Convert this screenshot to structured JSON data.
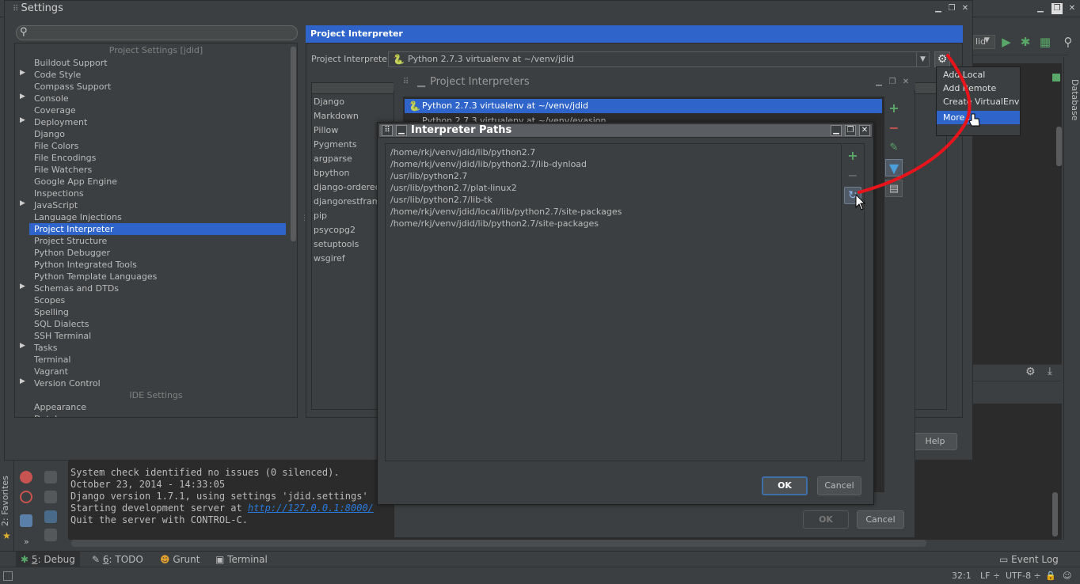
{
  "settings": {
    "title": "Settings",
    "tree_header_project": "Project Settings [jdid]",
    "tree_header_ide": "IDE Settings",
    "tree_items": [
      {
        "label": "Buildout Support",
        "expandable": false,
        "selected": false
      },
      {
        "label": "Code Style",
        "expandable": true,
        "selected": false
      },
      {
        "label": "Compass Support",
        "expandable": false,
        "selected": false
      },
      {
        "label": "Console",
        "expandable": true,
        "selected": false
      },
      {
        "label": "Coverage",
        "expandable": false,
        "selected": false
      },
      {
        "label": "Deployment",
        "expandable": true,
        "selected": false
      },
      {
        "label": "Django",
        "expandable": false,
        "selected": false
      },
      {
        "label": "File Colors",
        "expandable": false,
        "selected": false
      },
      {
        "label": "File Encodings",
        "expandable": false,
        "selected": false
      },
      {
        "label": "File Watchers",
        "expandable": false,
        "selected": false
      },
      {
        "label": "Google App Engine",
        "expandable": false,
        "selected": false
      },
      {
        "label": "Inspections",
        "expandable": false,
        "selected": false
      },
      {
        "label": "JavaScript",
        "expandable": true,
        "selected": false
      },
      {
        "label": "Language Injections",
        "expandable": false,
        "selected": false
      },
      {
        "label": "Project Interpreter",
        "expandable": false,
        "selected": true
      },
      {
        "label": "Project Structure",
        "expandable": false,
        "selected": false
      },
      {
        "label": "Python Debugger",
        "expandable": false,
        "selected": false
      },
      {
        "label": "Python Integrated Tools",
        "expandable": false,
        "selected": false
      },
      {
        "label": "Python Template Languages",
        "expandable": false,
        "selected": false
      },
      {
        "label": "Schemas and DTDs",
        "expandable": true,
        "selected": false
      },
      {
        "label": "Scopes",
        "expandable": false,
        "selected": false
      },
      {
        "label": "Spelling",
        "expandable": false,
        "selected": false
      },
      {
        "label": "SQL Dialects",
        "expandable": false,
        "selected": false
      },
      {
        "label": "SSH Terminal",
        "expandable": false,
        "selected": false
      },
      {
        "label": "Tasks",
        "expandable": true,
        "selected": false
      },
      {
        "label": "Terminal",
        "expandable": false,
        "selected": false
      },
      {
        "label": "Vagrant",
        "expandable": false,
        "selected": false
      },
      {
        "label": "Version Control",
        "expandable": true,
        "selected": false
      }
    ],
    "ide_items": [
      "Appearance",
      "Database"
    ],
    "panel_title": "Project Interpreter",
    "interpreter_label": "Project Interpreter:",
    "interpreter_value": "Python 2.7.3 virtualenv at ~/venv/jdid",
    "packages": [
      "Django",
      "Markdown",
      "Pillow",
      "Pygments",
      "argparse",
      "bpython",
      "django-ordered-",
      "djangorestframe",
      "pip",
      "psycopg2",
      "setuptools",
      "wsgiref"
    ],
    "help_label": "Help"
  },
  "gear_menu": {
    "items": [
      "Add Local",
      "Add Remote",
      "Create VirtualEnv",
      "More..."
    ],
    "selected": "More..."
  },
  "project_interpreters": {
    "title": "Project Interpreters",
    "items": [
      "Python 2.7.3 virtualenv at ~/venv/jdid",
      "Python 2.7.3 virtualenv at ~/venv/evasion"
    ],
    "ok_label": "OK",
    "cancel_label": "Cancel"
  },
  "interpreter_paths": {
    "title": "Interpreter Paths",
    "paths": [
      "/home/rkj/venv/jdid/lib/python2.7",
      "/home/rkj/venv/jdid/lib/python2.7/lib-dynload",
      "/usr/lib/python2.7",
      "/usr/lib/python2.7/plat-linux2",
      "/usr/lib/python2.7/lib-tk",
      "/home/rkj/venv/jdid/local/lib/python2.7/site-packages",
      "/home/rkj/venv/jdid/lib/python2.7/site-packages"
    ],
    "ok_label": "OK",
    "cancel_label": "Cancel"
  },
  "ide": {
    "run_config": "lid",
    "database_tab": "Database",
    "favorites_tab": "2: Favorites",
    "console_lines": [
      "System check identified no issues (0 silenced).",
      "October 23, 2014 - 14:33:05",
      "Django version 1.7.1, using settings 'jdid.settings'"
    ],
    "console_server_prefix": "Starting development server at ",
    "console_server_url": "http://127.0.0.1:8000/",
    "console_quit": "Quit the server with CONTROL-C.",
    "tool_tabs": [
      {
        "num": "5",
        "label": ": Debug"
      },
      {
        "num": "6",
        "label": ": TODO"
      },
      {
        "num": "",
        "label": "Grunt"
      },
      {
        "num": "",
        "label": "Terminal"
      }
    ],
    "event_log": "Event Log",
    "status_position": "32:1",
    "status_line_ending": "LF ÷",
    "status_encoding": "UTF-8 ÷"
  },
  "colors": {
    "selection": "#2f65ca",
    "background": "#3c3f41",
    "annotation": "#e8141b",
    "add_green": "#59a869",
    "remove_red": "#c75450"
  }
}
